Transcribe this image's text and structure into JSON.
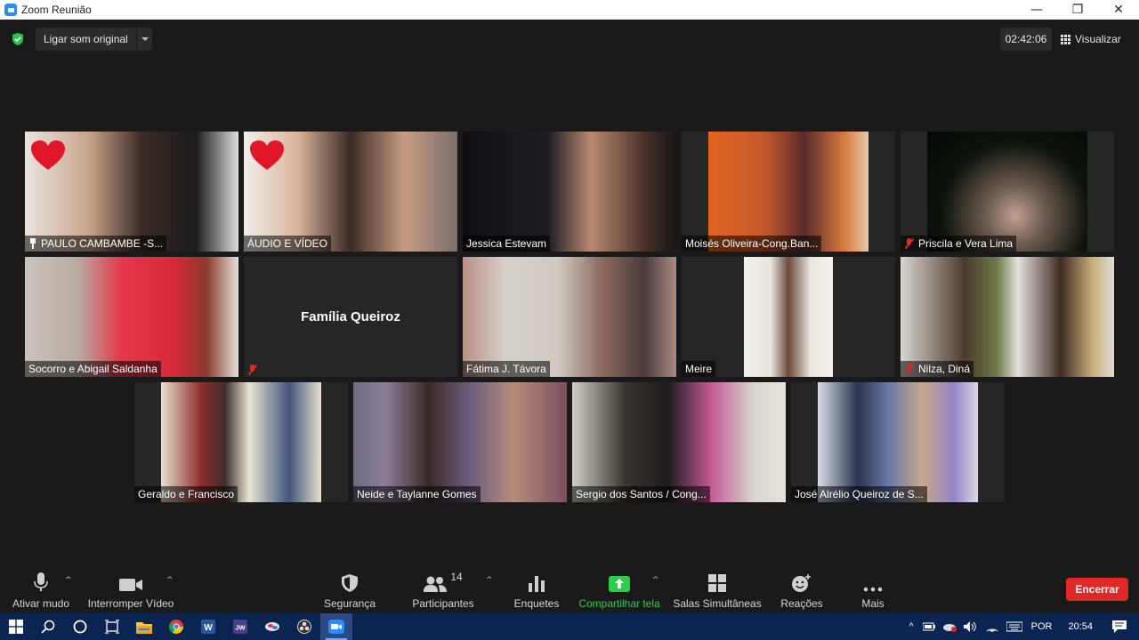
{
  "window": {
    "title": "Zoom Reunião",
    "controls": [
      "—",
      "❐",
      "✕"
    ]
  },
  "top_bar": {
    "original_sound_label": "Ligar som original",
    "timer": "02:42:06",
    "view_label": "Visualizar"
  },
  "participants": [
    {
      "name": "PAULO CAMBAMBE -S...",
      "status": "pinned",
      "reaction": "heart"
    },
    {
      "name": "ÁUDIO E VÍDEO",
      "status": "",
      "reaction": "heart"
    },
    {
      "name": "Jessica Estevam",
      "status": "",
      "reaction": ""
    },
    {
      "name": "Moisés Oliveira-Cong.Ban...",
      "status": "",
      "reaction": ""
    },
    {
      "name": "Priscila e Vera Lima",
      "status": "muted",
      "reaction": ""
    },
    {
      "name": "Socorro e Abigail Saldanha",
      "status": "",
      "reaction": ""
    },
    {
      "name": "Família Queiroz",
      "status": "muted",
      "reaction": "",
      "video_off": true
    },
    {
      "name": "Fátima J. Távora",
      "status": "",
      "reaction": ""
    },
    {
      "name": "Meire",
      "status": "",
      "reaction": ""
    },
    {
      "name": "Nilza, Diná",
      "status": "muted",
      "reaction": ""
    },
    {
      "name": "Geraldo e Francisco",
      "status": "",
      "reaction": ""
    },
    {
      "name": "Neide e Taylanne Gomes",
      "status": "active_speaker",
      "reaction": ""
    },
    {
      "name": "Sergio dos Santos / Cong...",
      "status": "",
      "reaction": ""
    },
    {
      "name": "José Alrélio Queiroz de S...",
      "status": "",
      "reaction": ""
    }
  ],
  "toolbar": {
    "mute_label": "Ativar mudo",
    "video_label": "Interromper Vídeo",
    "security_label": "Segurança",
    "participants_label": "Participantes",
    "participants_count": "14",
    "polls_label": "Enquetes",
    "share_label": "Compartilhar tela",
    "breakout_label": "Salas Simultâneas",
    "reactions_label": "Reações",
    "more_label": "Mais",
    "end_label": "Encerrar"
  },
  "taskbar": {
    "apps": [
      "windows-start",
      "search",
      "cortana",
      "task-view",
      "file-explorer",
      "chrome",
      "word",
      "jw-library",
      "app",
      "obs",
      "zoom"
    ],
    "language": "POR",
    "time": "20:54"
  },
  "colors": {
    "accent_green": "#2fcc4d",
    "end_red": "#e02828",
    "active_speaker": "#d6e36e",
    "taskbar_blue": "#0c2452"
  }
}
